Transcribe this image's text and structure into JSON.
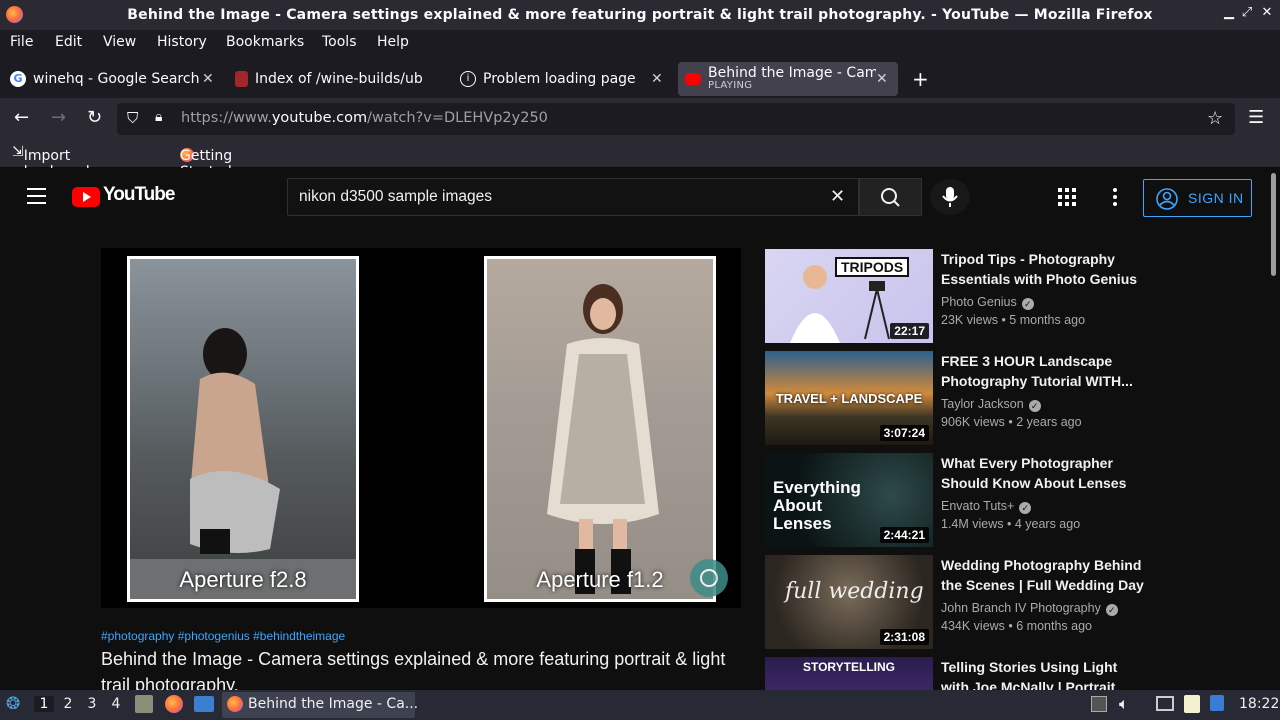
{
  "window": {
    "title": "Behind the Image - Camera settings explained & more featuring portrait & light trail photography. - YouTube — Mozilla Firefox"
  },
  "menu": [
    "File",
    "Edit",
    "View",
    "History",
    "Bookmarks",
    "Tools",
    "Help"
  ],
  "tabs": [
    {
      "label": "winehq - Google Search",
      "favicon": "google-icon"
    },
    {
      "label": "Index of /wine-builds/ubu",
      "favicon": "wine-icon"
    },
    {
      "label": "Problem loading page",
      "favicon": "info-icon"
    },
    {
      "label": "Behind the Image - Came",
      "sublabel": "PLAYING",
      "favicon": "youtube-icon",
      "active": true
    }
  ],
  "address": {
    "prefix": "https://www.",
    "host": "youtube.com",
    "path": "/watch?v=DLEHVp2y250"
  },
  "bookmarks": [
    "Import bookmarks...",
    "Getting Started"
  ],
  "youtube": {
    "logo_text": "YouTube",
    "search_value": "nikon d3500 sample images",
    "sign_in": "SIGN IN"
  },
  "player": {
    "left_caption": "Aperture f2.8",
    "right_caption": "Aperture f1.2"
  },
  "video": {
    "hashtags": "#photography #photogenius #behindtheimage",
    "title": "Behind the Image - Camera settings explained & more featuring portrait & light trail photography."
  },
  "recommendations": [
    {
      "title": "Tripod Tips - Photography Essentials with Photo Genius",
      "channel": "Photo Genius",
      "meta": "23K views • 5 months ago",
      "duration": "22:17",
      "thumb_text": "TRIPODS"
    },
    {
      "title": "FREE 3 HOUR Landscape Photography Tutorial WITH...",
      "channel": "Taylor Jackson",
      "meta": "906K views • 2 years ago",
      "duration": "3:07:24",
      "thumb_text": "TRAVEL + LANDSCAPE"
    },
    {
      "title": "What Every Photographer Should Know About Lenses",
      "channel": "Envato Tuts+",
      "meta": "1.4M views • 4 years ago",
      "duration": "2:44:21",
      "thumb_text": "Everything About Lenses"
    },
    {
      "title": "Wedding Photography Behind the Scenes | Full Wedding Day ...",
      "channel": "John Branch IV Photography",
      "meta": "434K views • 6 months ago",
      "duration": "2:31:08",
      "thumb_text": "full wedding"
    },
    {
      "title": "Telling Stories Using Light with Joe McNally | Portrait",
      "channel": "",
      "meta": "",
      "duration": "",
      "thumb_text": "STORYTELLING"
    }
  ],
  "taskbar": {
    "workspaces": [
      "1",
      "2",
      "3",
      "4"
    ],
    "task_label": "Behind the Image - Ca...",
    "clock": "18:22"
  }
}
